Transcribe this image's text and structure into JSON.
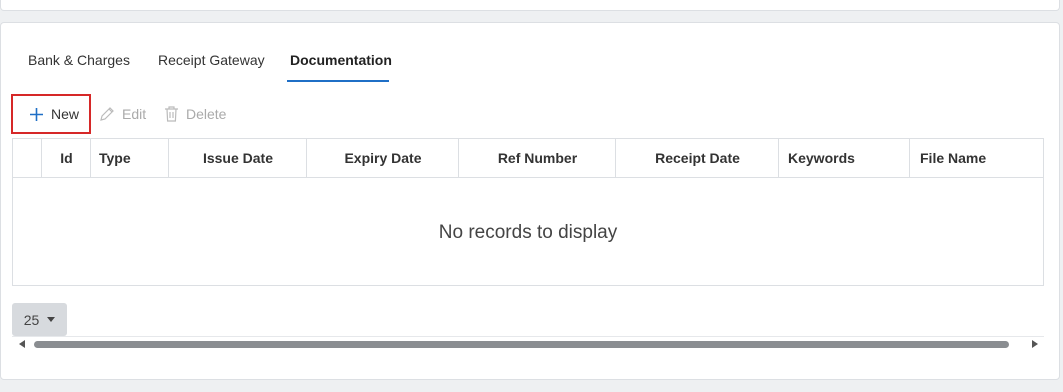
{
  "tabs": [
    {
      "label": "Bank & Charges",
      "active": false
    },
    {
      "label": "Receipt Gateway",
      "active": false
    },
    {
      "label": "Documentation",
      "active": true
    }
  ],
  "toolbar": {
    "new_label": "New",
    "edit_label": "Edit",
    "delete_label": "Delete"
  },
  "grid": {
    "columns": [
      "Id",
      "Type",
      "Issue Date",
      "Expiry Date",
      "Ref Number",
      "Receipt Date",
      "Keywords",
      "File Name"
    ],
    "empty_message": "No records to display"
  },
  "pager": {
    "page_size": "25"
  },
  "colors": {
    "accent": "#1f6fc6",
    "highlight_border": "#d62828"
  },
  "icons": {
    "new": "plus-icon",
    "edit": "pencil-icon",
    "delete": "trash-icon"
  }
}
